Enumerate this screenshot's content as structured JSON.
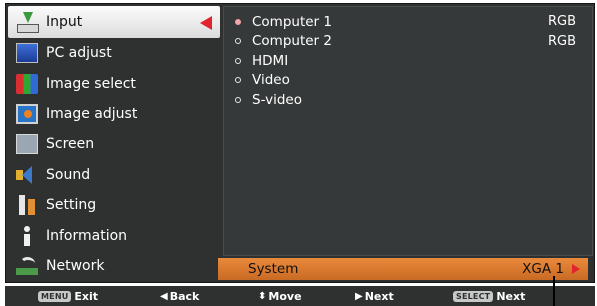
{
  "menu": {
    "items": [
      {
        "label": "Input",
        "icon": "input-icon",
        "active": true
      },
      {
        "label": "PC adjust",
        "icon": "pc-adjust-icon"
      },
      {
        "label": "Image select",
        "icon": "image-select-icon"
      },
      {
        "label": "Image adjust",
        "icon": "image-adjust-icon"
      },
      {
        "label": "Screen",
        "icon": "screen-icon"
      },
      {
        "label": "Sound",
        "icon": "sound-icon"
      },
      {
        "label": "Setting",
        "icon": "setting-icon"
      },
      {
        "label": "Information",
        "icon": "information-icon"
      },
      {
        "label": "Network",
        "icon": "network-icon"
      }
    ]
  },
  "sources": [
    {
      "label": "Computer 1",
      "value": "RGB",
      "selected": true
    },
    {
      "label": "Computer 2",
      "value": "RGB"
    },
    {
      "label": "HDMI",
      "value": ""
    },
    {
      "label": "Video",
      "value": ""
    },
    {
      "label": "S-video",
      "value": ""
    }
  ],
  "system": {
    "label": "System",
    "value": "XGA 1"
  },
  "footer": {
    "exit_key": "MENU",
    "exit": "Exit",
    "back": "Back",
    "move": "Move",
    "next": "Next",
    "select_key": "SELECT",
    "select_next": "Next"
  },
  "colors": {
    "accent": "#e3232b",
    "system_bar": "#e07f34",
    "osd_bg": "#2f3131"
  }
}
